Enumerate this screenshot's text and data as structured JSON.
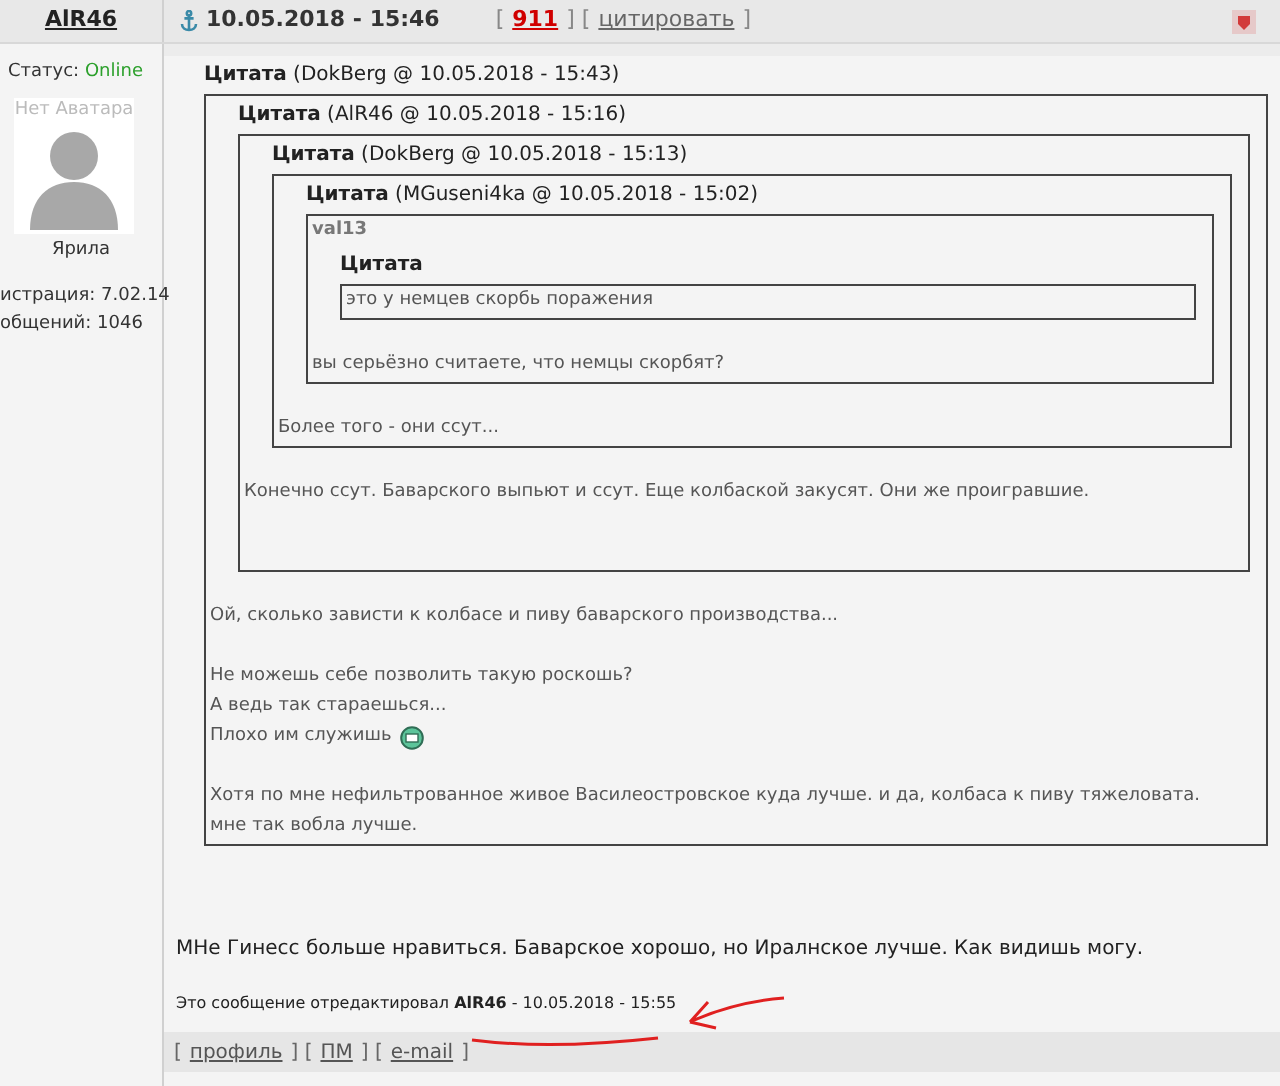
{
  "header": {
    "author": "AlR46",
    "timestamp": "10.05.2018 - 15:46",
    "actions": [
      {
        "kind": "text",
        "text": "["
      },
      {
        "kind": "count",
        "text": "911"
      },
      {
        "kind": "text",
        "text": "] ["
      },
      {
        "kind": "link",
        "text": "цитировать"
      },
      {
        "kind": "text",
        "text": "]"
      }
    ]
  },
  "profile": {
    "status_label": "Статус:",
    "status": "Online",
    "avatar_text": "Нет Аватара",
    "rank": "Ярила",
    "registration": "истрация: 7.02.14",
    "posts": "общений: 1046"
  },
  "quote": {
    "label": "Цитата",
    "source": "(DokBerg @ 10.05.2018 - 15:43)",
    "body": [
      {
        "kind": "quote",
        "label": "Цитата",
        "source": "(AlR46 @ 10.05.2018 - 15:16)",
        "body": [
          {
            "kind": "quote",
            "label": "Цитата",
            "source": "(DokBerg @ 10.05.2018 - 15:13)",
            "body": [
              {
                "kind": "quote",
                "label": "Цитата",
                "source": "(MGuseni4ka @ 10.05.2018 - 15:02)",
                "body": [
                  {
                    "kind": "name",
                    "text": "val13"
                  },
                  {
                    "kind": "quote",
                    "label": "Цитата",
                    "body": [
                      {
                        "kind": "text",
                        "text": "это у немцев скорбь поражения"
                      }
                    ]
                  },
                  {
                    "kind": "break"
                  },
                  {
                    "kind": "text",
                    "text": "вы серьёзно считаете, что немцы скорбят?"
                  }
                ]
              },
              {
                "kind": "break"
              },
              {
                "kind": "text",
                "text": "Более того - они ссут..."
              }
            ]
          },
          {
            "kind": "break"
          },
          {
            "kind": "text",
            "text": "Конечно ссут. Баварского выпьют и ссут. Еще колбаской закусят. Они же проигравшие."
          },
          {
            "kind": "break"
          },
          {
            "kind": "break"
          }
        ]
      },
      {
        "kind": "break"
      },
      {
        "kind": "text",
        "text": "Ой, сколько зависти к колбасе и пиву баварского производства..."
      },
      {
        "kind": "break"
      },
      {
        "kind": "text",
        "text": "Не можешь себе позволить такую роскошь?"
      },
      {
        "kind": "text",
        "text": "А ведь так стараешься..."
      },
      {
        "kind": "text",
        "text": "Плохо им служишь",
        "emoticon": true
      },
      {
        "kind": "break"
      },
      {
        "kind": "text",
        "text": "Хотя по мне нефильтрованное живое Василеостровское куда лучше. и да, колбаса к пиву тяжеловата."
      },
      {
        "kind": "text",
        "text": "мне так вобла лучше."
      }
    ]
  },
  "reply": "МНе Гинесс больше нравиться. Баварское хорошо, но Иралнское лучше. Как видишь могу.",
  "edit_note": "Это сообщение отредактировал **AlR46** - 10.05.2018 - 15:55",
  "footer": [
    {
      "kind": "text",
      "text": "["
    },
    {
      "kind": "link",
      "text": "профиль"
    },
    {
      "kind": "text",
      "text": "] ["
    },
    {
      "kind": "link",
      "text": "ПМ"
    },
    {
      "kind": "text",
      "text": "] ["
    },
    {
      "kind": "link",
      "text": "e-mail"
    },
    {
      "kind": "text",
      "text": "]"
    }
  ]
}
